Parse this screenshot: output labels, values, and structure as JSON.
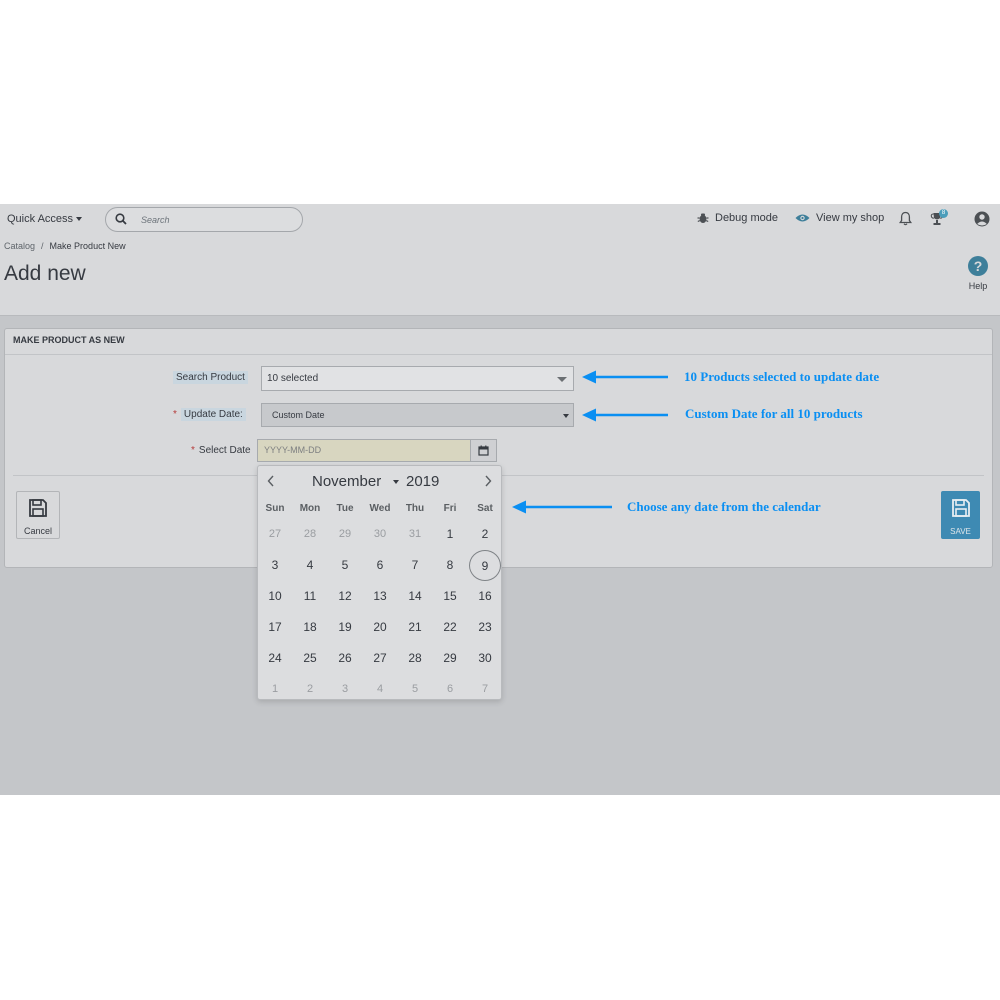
{
  "header": {
    "quick_access": "Quick Access",
    "search_placeholder": "Search",
    "debug_mode": "Debug mode",
    "view_shop": "View my shop",
    "notification_badge": "8"
  },
  "breadcrumb": {
    "parent": "Catalog",
    "separator": "/",
    "current": "Make Product New"
  },
  "page_title": "Add new",
  "help_label": "Help",
  "panel": {
    "heading": "MAKE PRODUCT AS NEW",
    "search_product_label": "Search Product",
    "search_product_value": "10 selected",
    "update_date_label": "Update Date:",
    "update_date_value": "Custom Date",
    "select_date_label": "Select Date",
    "date_placeholder": "YYYY-MM-DD",
    "cancel_label": "Cancel",
    "save_label": "SAVE"
  },
  "calendar": {
    "month": "November",
    "year": "2019",
    "weekdays": [
      "Sun",
      "Mon",
      "Tue",
      "Wed",
      "Thu",
      "Fri",
      "Sat"
    ],
    "weeks": [
      [
        "27",
        "28",
        "29",
        "30",
        "31",
        "1",
        "2"
      ],
      [
        "3",
        "4",
        "5",
        "6",
        "7",
        "8",
        "9"
      ],
      [
        "10",
        "11",
        "12",
        "13",
        "14",
        "15",
        "16"
      ],
      [
        "17",
        "18",
        "19",
        "20",
        "21",
        "22",
        "23"
      ],
      [
        "24",
        "25",
        "26",
        "27",
        "28",
        "29",
        "30"
      ],
      [
        "1",
        "2",
        "3",
        "4",
        "5",
        "6",
        "7"
      ]
    ],
    "selected_day": "9"
  },
  "annotations": {
    "products": "10 Products selected to update date",
    "custom_date": "Custom Date for all 10 products",
    "choose_date": "Choose any date from the calendar"
  },
  "colors": {
    "accent": "#3e8ab3",
    "annotation": "#0a8ff2",
    "required": "#b53a3a"
  }
}
